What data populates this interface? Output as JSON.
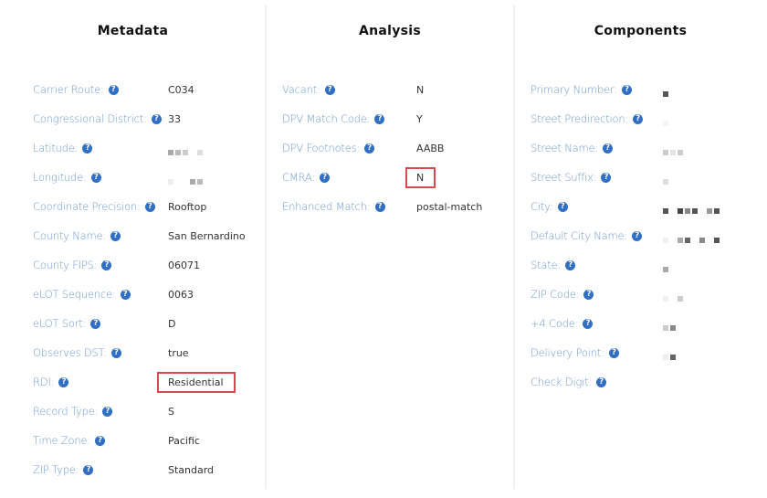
{
  "accent_colors": {
    "label": "#6b9bd1",
    "help_icon": "#2f6fc4",
    "highlight_border": "#d9474f"
  },
  "metadata": {
    "title": "Metadata",
    "rows": [
      {
        "label": "Carrier Route:",
        "value": "C034"
      },
      {
        "label": "Congressional District:",
        "value": "33"
      },
      {
        "label": "Latitude:",
        "value": "[redacted]"
      },
      {
        "label": "Longitude:",
        "value": "[redacted]"
      },
      {
        "label": "Coordinate Precision:",
        "value": "Rooftop"
      },
      {
        "label": "County Name:",
        "value": "San Bernardino"
      },
      {
        "label": "County FIPS:",
        "value": "06071"
      },
      {
        "label": "eLOT Sequence:",
        "value": "0063"
      },
      {
        "label": "eLOT Sort:",
        "value": "D"
      },
      {
        "label": "Observes DST:",
        "value": "true"
      },
      {
        "label": "RDI:",
        "value": "Residential",
        "highlighted": true
      },
      {
        "label": "Record Type:",
        "value": "S"
      },
      {
        "label": "Time Zone:",
        "value": "Pacific"
      },
      {
        "label": "ZIP Type:",
        "value": "Standard"
      }
    ]
  },
  "analysis": {
    "title": "Analysis",
    "rows": [
      {
        "label": "Vacant:",
        "value": "N"
      },
      {
        "label": "DPV Match Code:",
        "value": "Y"
      },
      {
        "label": "DPV Footnotes:",
        "value": "AABB"
      },
      {
        "label": "CMRA:",
        "value": "N",
        "highlighted": true
      },
      {
        "label": "Enhanced Match:",
        "value": "postal-match"
      }
    ]
  },
  "components": {
    "title": "Components",
    "rows": [
      {
        "label": "Primary Number:",
        "value": "[redacted]"
      },
      {
        "label": "Street Predirection:",
        "value": "[redacted]"
      },
      {
        "label": "Street Name:",
        "value": "[redacted]"
      },
      {
        "label": "Street Suffix:",
        "value": "[redacted]"
      },
      {
        "label": "City:",
        "value": "[redacted]"
      },
      {
        "label": "Default City Name:",
        "value": "[redacted]"
      },
      {
        "label": "State:",
        "value": "[redacted]"
      },
      {
        "label": "ZIP Code:",
        "value": "[redacted]"
      },
      {
        "label": "+4 Code:",
        "value": "[redacted]"
      },
      {
        "label": "Delivery Point:",
        "value": "[redacted]"
      },
      {
        "label": "Check Digit:",
        "value": ""
      }
    ]
  },
  "help_icon_glyph": "?"
}
